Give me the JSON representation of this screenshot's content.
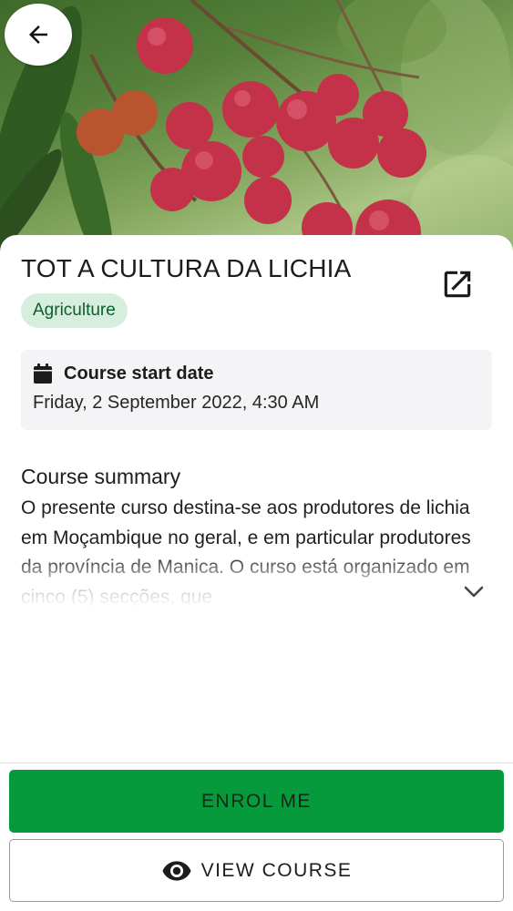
{
  "hero": {
    "image_subject": "lychee-fruit-photo"
  },
  "header": {
    "back_icon": "arrow-left-icon",
    "share_icon": "open-in-new-icon"
  },
  "course": {
    "title": "TOT A CULTURA DA LICHIA",
    "category": "Agriculture",
    "start_date_label": "Course start date",
    "start_date_value": "Friday, 2 September 2022, 4:30 AM",
    "summary_title": "Course summary",
    "summary_text": "O presente curso destina-se aos produtores de lichia em Moçambique no geral, e em particular produtores da província de Manica. O curso está organizado em cinco (5) secções, que"
  },
  "actions": {
    "enrol_label": "ENROL ME",
    "view_label": "VIEW COURSE"
  },
  "colors": {
    "primary_green": "#079a3d",
    "chip_bg": "#d6eedd",
    "chip_text": "#0e5e2c",
    "card_bg": "#f4f4f6"
  }
}
